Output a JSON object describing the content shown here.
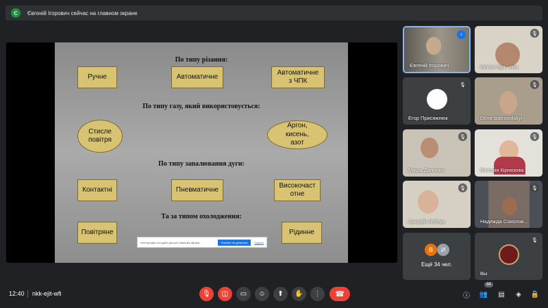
{
  "banner": {
    "text": "Євгеній Ігорович сейчас на главном экране",
    "icon": "Є"
  },
  "slide": {
    "headings": [
      "По типу різання:",
      "По типу газу, який використовується:",
      "По типу запалювання дуги:",
      "Та за типом охолодження:"
    ],
    "cutting": [
      "Ручне",
      "Автоматичне",
      "Автоматичне\nз ЧПК"
    ],
    "gas": [
      "Стисле\nповітря",
      "Аргон,\nкисень,\nазот"
    ],
    "ignition": [
      "Контактні",
      "Пневматичне",
      "Високочаст\nотне"
    ],
    "cooling": [
      "Повітряне",
      "Рідинне"
    ]
  },
  "toast": {
    "message": "meet.google.com дает доступ к вашему экрану.",
    "button": "Больше не делиться",
    "link": "Скрыть"
  },
  "participants": [
    {
      "name": "Євгеній Ігорович"
    },
    {
      "name": "Ирина Кул...ина"
    },
    {
      "name": "Егор Присяжнюк"
    },
    {
      "name": "Dima dobrovolskyi"
    },
    {
      "name": "Миша Данилюк"
    },
    {
      "name": "Вікторія Кірнязова"
    },
    {
      "name": "Аркадій Лебедь"
    },
    {
      "name": "Надежда Соколов..."
    },
    {
      "name": "Ещё 34 чел.",
      "initials": [
        "В",
        "И"
      ]
    },
    {
      "name": "Вы"
    }
  ],
  "bottom": {
    "time": "12:40",
    "meeting_code": "nkk-ejit-wfi",
    "participants_count": "44"
  },
  "colors": {
    "hangup": "#ea4335",
    "slide_box": "#d8c373",
    "active_speaker": "#8ab4f8"
  },
  "icons": [
    "mic-off-icon",
    "camera-off-icon",
    "captions-icon",
    "emoji-icon",
    "present-icon",
    "hand-icon",
    "more-icon",
    "hangup-icon",
    "info-icon",
    "people-icon",
    "chat-icon",
    "activities-icon",
    "lock-icon"
  ]
}
